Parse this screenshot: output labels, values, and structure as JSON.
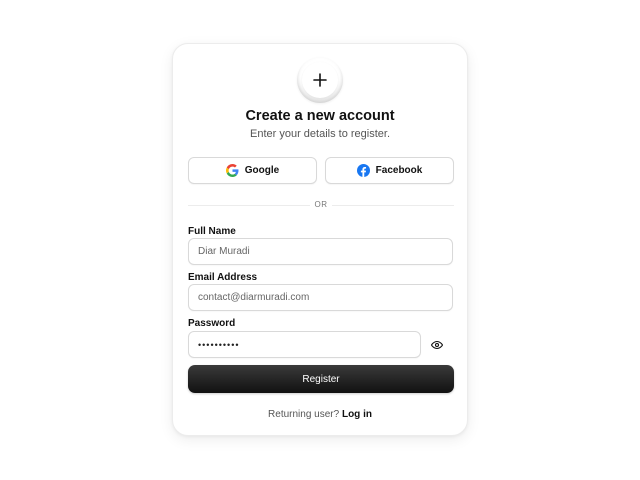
{
  "header": {
    "logo_icon": "plus-icon",
    "title": "Create a new account",
    "subtitle": "Enter your details to register."
  },
  "social": {
    "google_label": "Google",
    "facebook_label": "Facebook",
    "google_icon": "google-icon",
    "facebook_icon": "facebook-icon"
  },
  "divider": {
    "text": "OR"
  },
  "form": {
    "full_name": {
      "label": "Full Name",
      "value": "Diar Muradi"
    },
    "email": {
      "label": "Email Address",
      "value": "contact@diarmuradi.com"
    },
    "password": {
      "label": "Password",
      "value": "••••••••••",
      "toggle_icon": "eye-icon"
    }
  },
  "actions": {
    "register_label": "Register"
  },
  "footer": {
    "prompt": "Returning user?",
    "link": "Log in"
  },
  "colors": {
    "primary_button": "#111111",
    "facebook_blue": "#1877F2",
    "border": "#d9d9d9"
  }
}
